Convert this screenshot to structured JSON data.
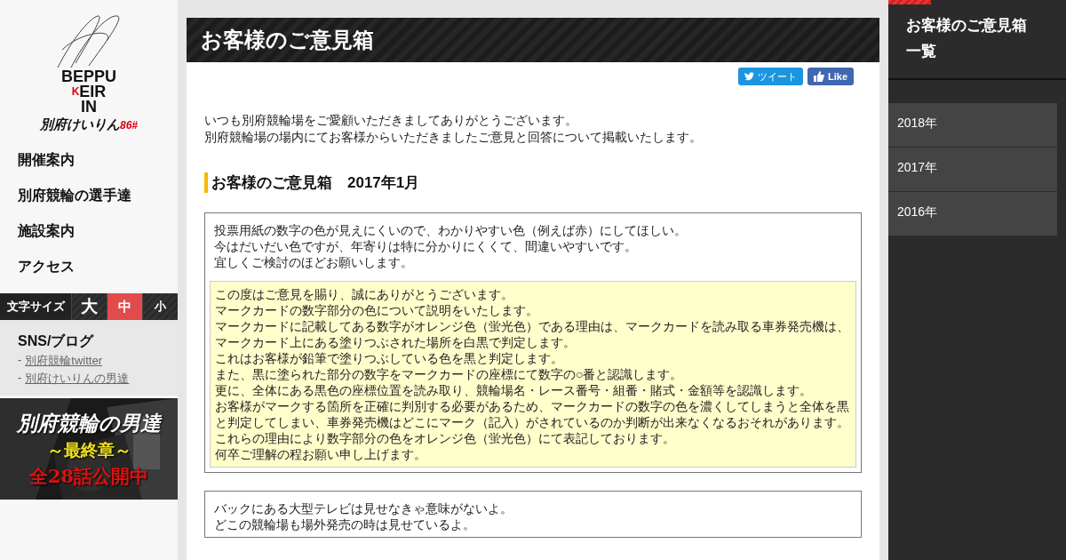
{
  "logo": {
    "top": [
      "BE",
      "PPU"
    ],
    "middle": [
      "K",
      "EIR"
    ],
    "bottom": "IN",
    "kana": "別府けいりん",
    "number": "86#"
  },
  "nav": [
    "開催案内",
    "別府競輪の選手達",
    "施設案内",
    "アクセス"
  ],
  "font_size": {
    "label": "文字サイズ",
    "options": [
      {
        "label": "大",
        "selected": false
      },
      {
        "label": "中",
        "selected": true
      },
      {
        "label": "小",
        "selected": false
      }
    ]
  },
  "sns": {
    "title": "SNS/ブログ",
    "links": [
      {
        "bullet": "-",
        "label": "別府競輪twitter"
      },
      {
        "bullet": "-",
        "label": "別府けいりんの男達"
      }
    ]
  },
  "banner": {
    "lines": [
      "別府競輪の男達",
      "～最終章～",
      "全28話公開中"
    ]
  },
  "page_title": "お客様のご意見箱",
  "share": [
    {
      "kind": "tweet",
      "label": "ツイート"
    },
    {
      "kind": "like",
      "label": "Like"
    }
  ],
  "intro": [
    "いつも別府競輪場をご愛顧いただきましてありがとうございます。",
    "別府競輪場の場内にてお客様からいただきましたご意見と回答について掲載いたします。"
  ],
  "section_title": "お客様のご意見箱　2017年1月",
  "entries": [
    {
      "opinion": [
        "投票用紙の数字の色が見えにくいので、わかりやすい色（例えば赤）にしてほしい。",
        "今はだいだい色ですが、年寄りは特に分かりにくくて、間違いやすいです。",
        "宜しくご検討のほどお願いします。"
      ],
      "answer": [
        "この度はご意見を賜り、誠にありがとうございます。",
        "マークカードの数字部分の色について説明をいたします。",
        "マークカードに記載してある数字がオレンジ色（蛍光色）である理由は、マークカードを読み取る車券発売機は、マークカード上にある塗りつぶされた場所を白黒で判定します。",
        "これはお客様が鉛筆で塗りつぶしている色を黒と判定します。",
        "また、黒に塗られた部分の数字をマークカードの座標にて数字の○番と認識します。",
        "更に、全体にある黒色の座標位置を読み取り、競輪場名・レース番号・組番・賭式・金額等を認識します。",
        "お客様がマークする箇所を正確に判別する必要があるため、マークカードの数字の色を濃くしてしまうと全体を黒と判定してしまい、車券発売機はどこにマーク（記入）がされているのか判断が出来なくなるおそれがあります。",
        "これらの理由により数字部分の色をオレンジ色（蛍光色）にて表記しております。",
        "何卒ご理解の程お願い申し上げます。"
      ]
    },
    {
      "opinion": [
        "バックにある大型テレビは見せなきゃ意味がないよ。",
        "どこの競輪場も場外発売の時は見せているよ。"
      ]
    }
  ],
  "archive": {
    "title": "お客様のご意見箱一覧",
    "years": [
      "2018年",
      "2017年",
      "2016年"
    ]
  }
}
